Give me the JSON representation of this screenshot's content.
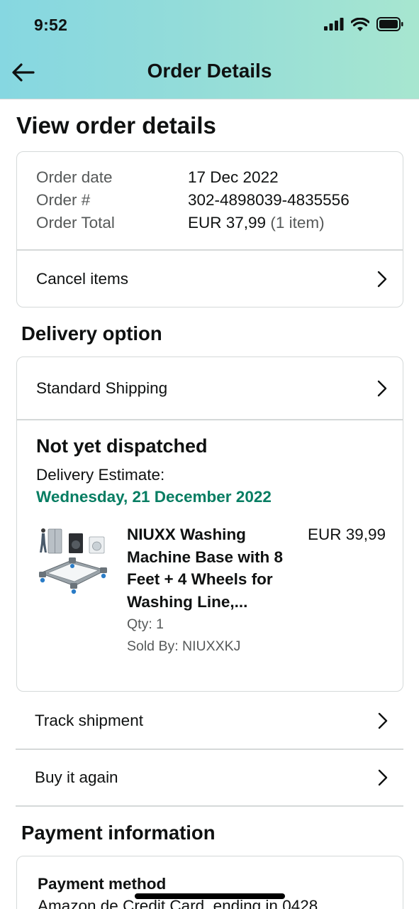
{
  "status_bar": {
    "time": "9:52"
  },
  "header": {
    "title": "Order Details"
  },
  "page_title": "View order details",
  "summary": {
    "rows": [
      {
        "label": "Order date",
        "value": "17 Dec 2022"
      },
      {
        "label": "Order #",
        "value": "302-4898039-4835556"
      },
      {
        "label": "Order Total",
        "value": "EUR 37,99",
        "extra": "(1 item)"
      }
    ],
    "cancel_label": "Cancel items"
  },
  "delivery": {
    "section_title": "Delivery option",
    "shipping_label": "Standard Shipping",
    "status": "Not yet dispatched",
    "estimate_label": "Delivery Estimate:",
    "estimate_date": "Wednesday, 21 December 2022",
    "estimate_color": "#067d62",
    "product": {
      "title": "NIUXX Washing Machine Base with 8 Feet + 4 Wheels for Washing Line,...",
      "price": "EUR 39,99",
      "qty": "Qty: 1",
      "seller": "Sold By: NIUXXKJ"
    }
  },
  "actions": {
    "track_label": "Track shipment",
    "buy_again_label": "Buy it again"
  },
  "payment": {
    "section_title": "Payment information",
    "method_heading": "Payment method",
    "method_text": "Amazon.de Credit Card, ending in 0428"
  },
  "icons": {
    "back": "arrow-left-icon",
    "chevron": "chevron-right-icon",
    "signal": "signal-icon",
    "wifi": "wifi-icon",
    "battery": "battery-icon"
  }
}
